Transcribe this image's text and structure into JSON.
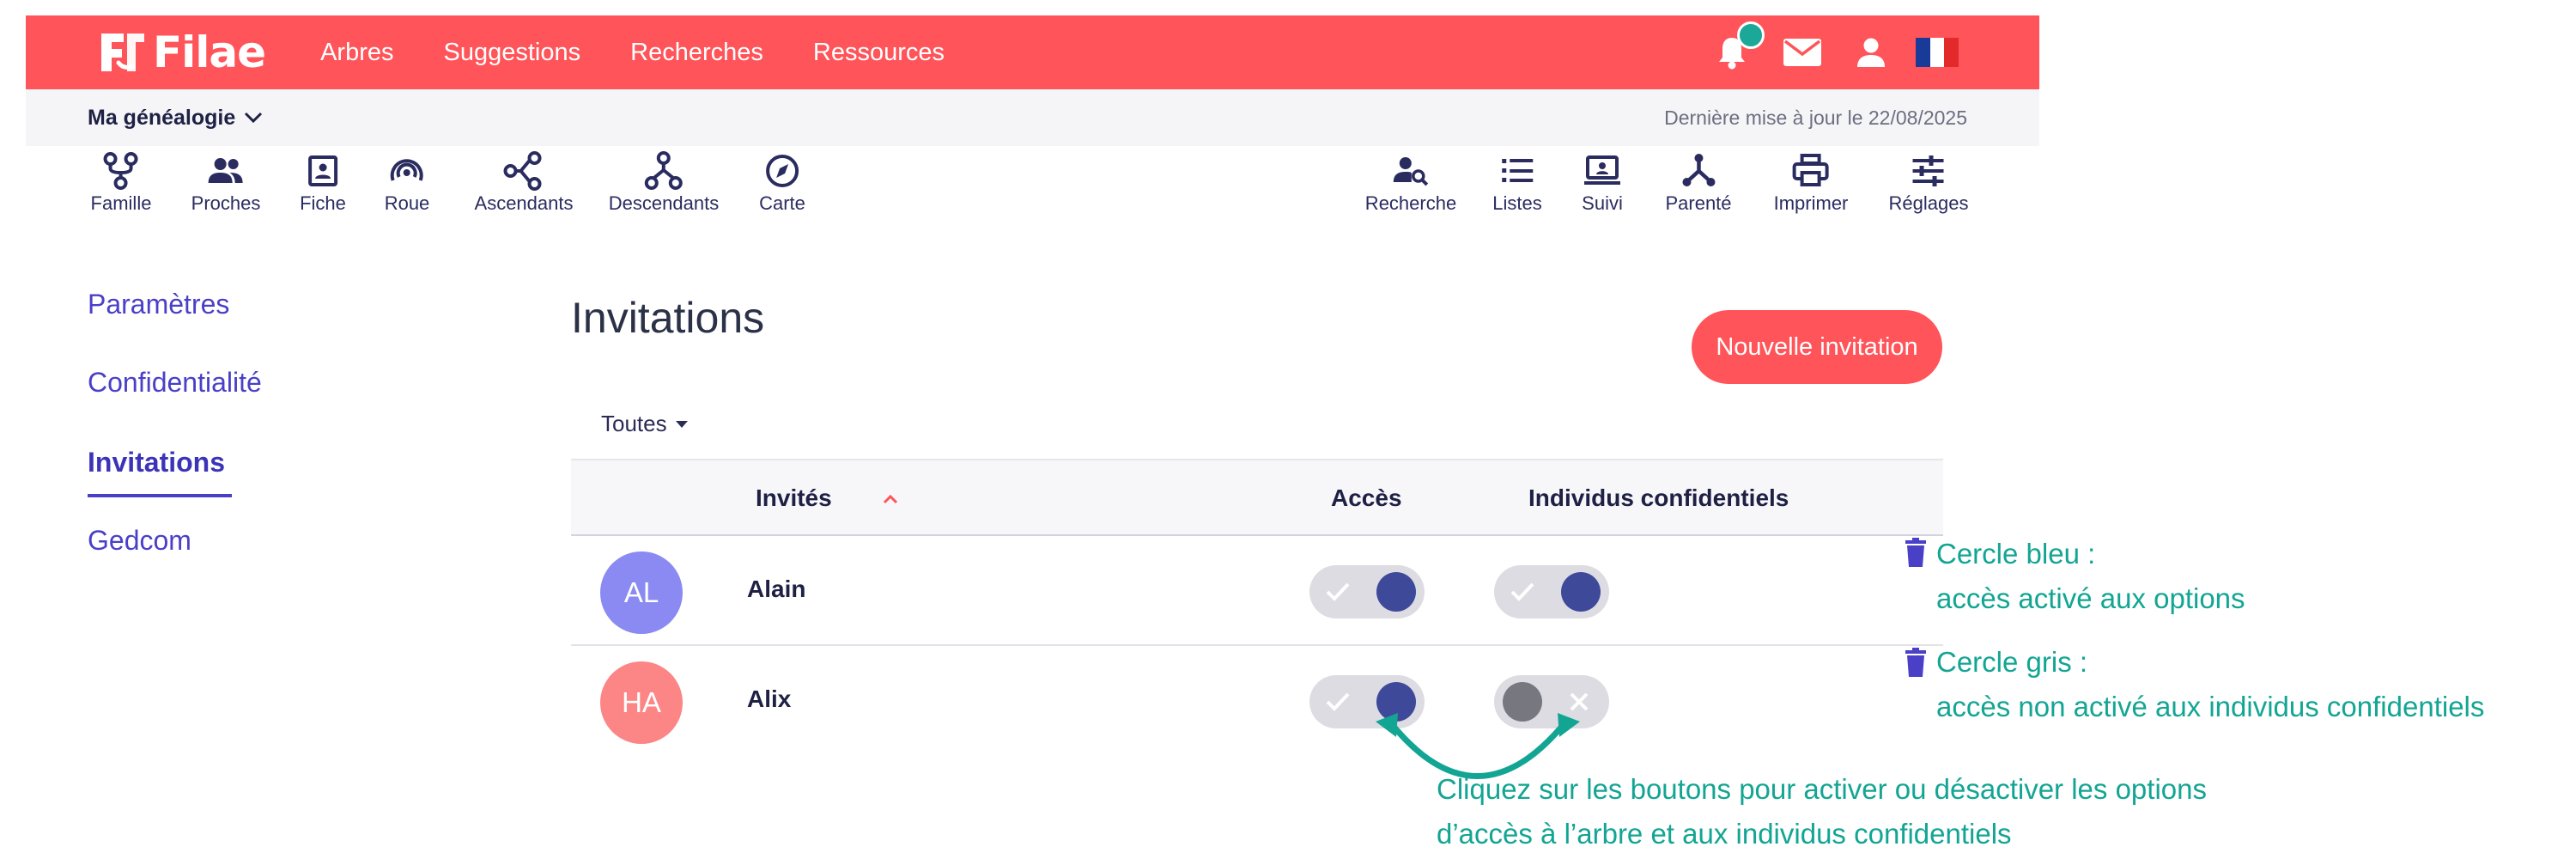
{
  "brand": {
    "name": "Filae"
  },
  "nav": {
    "items": [
      "Arbres",
      "Suggestions",
      "Recherches",
      "Ressources"
    ]
  },
  "top_icons": [
    "bell-icon",
    "mail-icon",
    "user-icon",
    "french-flag-icon"
  ],
  "colors": {
    "brand_red": "#ff5459",
    "accent_purple": "#4a40c8",
    "toggle_on": "#3e4999",
    "annotation_teal": "#13a593",
    "notification": "#1ba898"
  },
  "subbar": {
    "tree_selector": "Ma généalogie",
    "last_update": "Dernière mise à jour le 22/08/2025"
  },
  "tools_left": [
    {
      "label": "Famille",
      "icon": "family-icon"
    },
    {
      "label": "Proches",
      "icon": "people-icon"
    },
    {
      "label": "Fiche",
      "icon": "profile-card-icon"
    },
    {
      "label": "Roue",
      "icon": "wheel-icon"
    },
    {
      "label": "Ascendants",
      "icon": "ascendants-icon"
    },
    {
      "label": "Descendants",
      "icon": "descendants-icon"
    },
    {
      "label": "Carte",
      "icon": "compass-icon"
    }
  ],
  "tools_right": [
    {
      "label": "Recherche",
      "icon": "person-search-icon"
    },
    {
      "label": "Listes",
      "icon": "list-icon"
    },
    {
      "label": "Suivi",
      "icon": "monitor-icon"
    },
    {
      "label": "Parenté",
      "icon": "kinship-icon"
    },
    {
      "label": "Imprimer",
      "icon": "print-icon"
    },
    {
      "label": "Réglages",
      "icon": "settings-sliders-icon"
    }
  ],
  "sidebar": {
    "items": [
      "Paramètres",
      "Confidentialité",
      "Invitations",
      "Gedcom"
    ],
    "active": "Invitations"
  },
  "main": {
    "title": "Invitations",
    "new_button": "Nouvelle invitation",
    "filter": "Toutes",
    "columns": {
      "guests": "Invités",
      "access": "Accès",
      "confidential": "Individus confidentiels"
    },
    "rows": [
      {
        "initials": "AL",
        "name": "Alain",
        "avatar_color": "#8a8af2",
        "access": true,
        "confidential": true
      },
      {
        "initials": "HA",
        "name": "Alix",
        "avatar_color": "#fc8686",
        "access": true,
        "confidential": false
      }
    ]
  },
  "annotations": {
    "blue_title": "Cercle bleu :",
    "blue_desc": "accès activé  aux options",
    "grey_title": "Cercle gris :",
    "grey_desc": "accès non activé aux individus  confidentiels",
    "click_line1": "Cliquez sur les boutons pour activer ou désactiver les options",
    "click_line2": "d’accès à l’arbre et aux individus confidentiels"
  }
}
